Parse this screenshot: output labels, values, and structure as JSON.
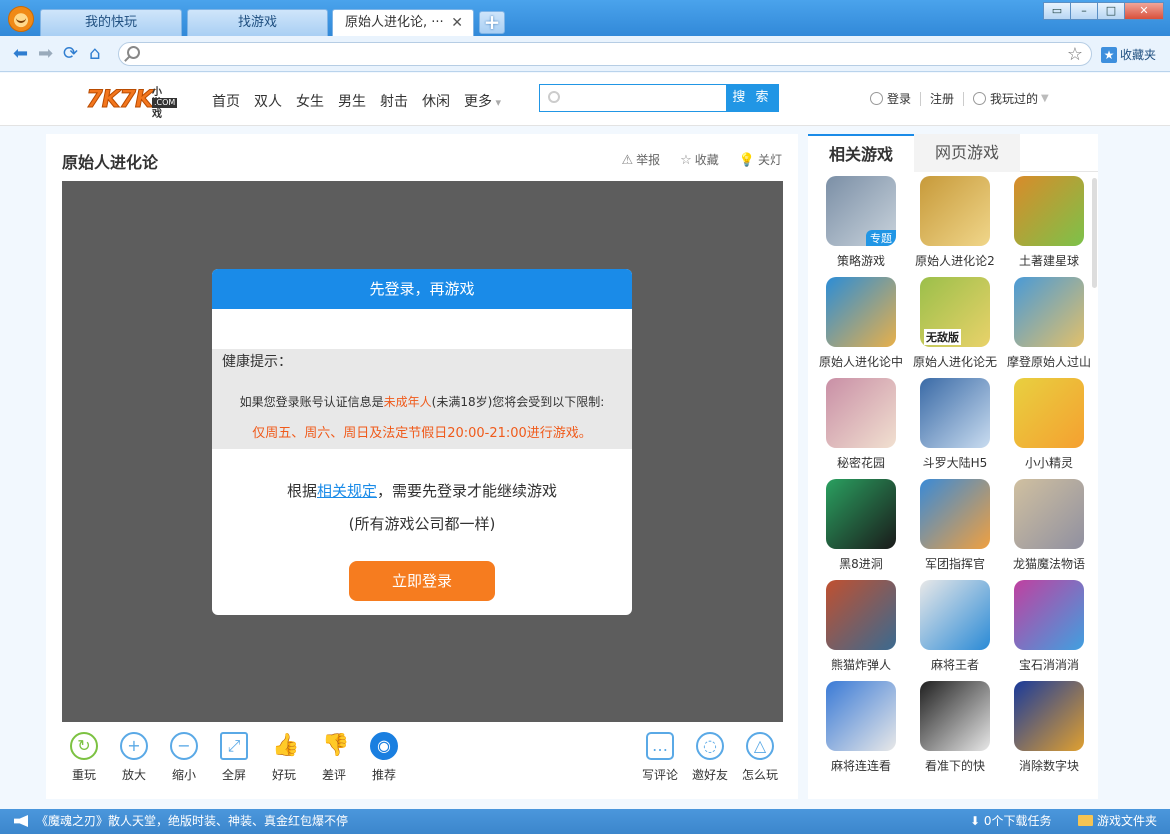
{
  "browser": {
    "tabs": [
      {
        "label": "我的快玩"
      },
      {
        "label": "找游戏"
      },
      {
        "label": "原始人进化论, ···",
        "close": "✕"
      }
    ],
    "new_tab": "+",
    "window_buttons": [
      "▭",
      "–",
      "□",
      "✕"
    ],
    "favorites_label": "收藏夹",
    "address_value": ""
  },
  "site": {
    "logo_main": "7K7K",
    "logo_sub": "小游戏",
    "logo_sub2": ".COM",
    "nav": [
      "首页",
      "双人",
      "女生",
      "男生",
      "射击",
      "休闲",
      "更多"
    ],
    "search_button": "搜 索",
    "search_placeholder": "",
    "login": "登录",
    "register": "注册",
    "played": "我玩过的"
  },
  "game": {
    "title": "原始人进化论",
    "tools": [
      "举报",
      "收藏",
      "关灯"
    ],
    "dialog": {
      "header": "先登录，再游戏",
      "tip_title": "健康提示：",
      "tip_line1_a": "如果您登录账号认证信息是",
      "tip_line1_red": "未成年人",
      "tip_line1_b": "(未满18岁)您将会受到以下限制:",
      "tip_line2": "仅周五、周六、周日及法定节假日20:00-21:00进行游戏。",
      "msg_a": "根据",
      "msg_link": "相关规定",
      "msg_b": "，需要先登录才能继续游戏",
      "msg2": "(所有游戏公司都一样)",
      "login_button": "立即登录"
    },
    "bottom_left": [
      "重玩",
      "放大",
      "缩小",
      "全屏",
      "好玩",
      "差评",
      "推荐"
    ],
    "bottom_right": [
      "写评论",
      "邀好友",
      "怎么玩"
    ]
  },
  "sidebar": {
    "tabs": [
      "相关游戏",
      "网页游戏"
    ],
    "games": [
      {
        "label": "策略游戏",
        "badge": "专题"
      },
      {
        "label": "原始人进化论2"
      },
      {
        "label": "土著建星球"
      },
      {
        "label": "原始人进化论中"
      },
      {
        "label": "原始人进化论无",
        "badge": "无敌版"
      },
      {
        "label": "摩登原始人过山"
      },
      {
        "label": "秘密花园"
      },
      {
        "label": "斗罗大陆H5"
      },
      {
        "label": "小小精灵"
      },
      {
        "label": "黑8进洞"
      },
      {
        "label": "军团指挥官"
      },
      {
        "label": "龙猫魔法物语"
      },
      {
        "label": "熊猫炸弹人"
      },
      {
        "label": "麻将王者"
      },
      {
        "label": "宝石消消消"
      },
      {
        "label": "麻将连连看"
      },
      {
        "label": "看准下的快"
      },
      {
        "label": "消除数字块"
      }
    ]
  },
  "status": {
    "news": "《魔魂之刃》散人天堂，绝版时装、神装、真金红包爆不停",
    "downloads": "0个下载任务",
    "folder": "游戏文件夹"
  }
}
